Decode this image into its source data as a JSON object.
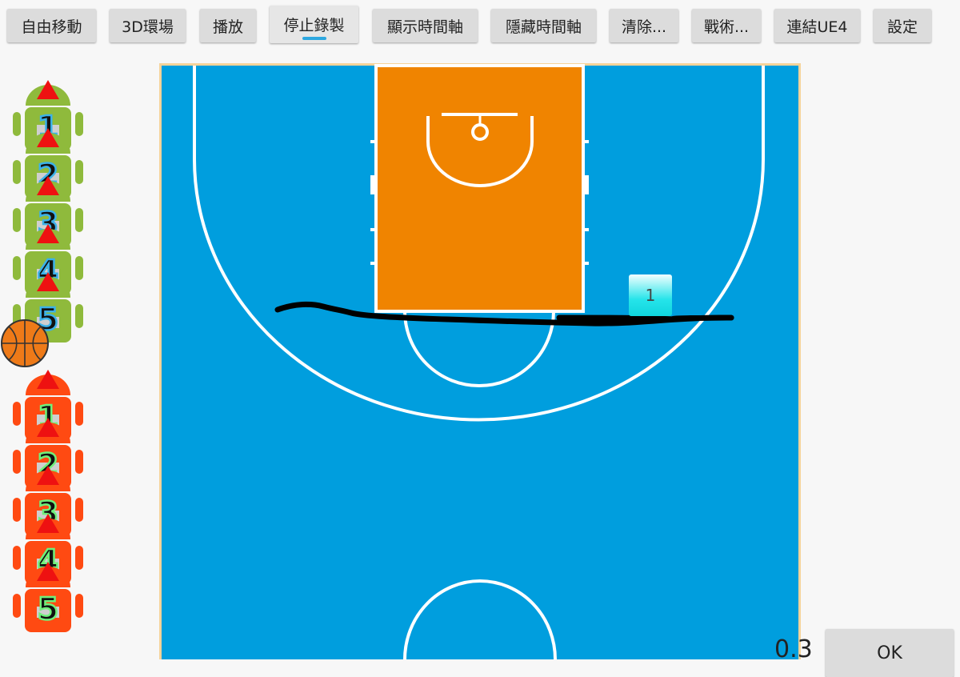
{
  "toolbar": {
    "buttons": [
      {
        "label": "自由移動"
      },
      {
        "label": "3D環場"
      },
      {
        "label": "播放"
      },
      {
        "label": "停止錄製"
      },
      {
        "label": "顯示時間軸"
      },
      {
        "label": "隱藏時間軸"
      },
      {
        "label": "清除..."
      },
      {
        "label": "戰術..."
      },
      {
        "label": "連結UE4"
      },
      {
        "label": "設定"
      }
    ]
  },
  "team_home": {
    "color": "#8fba3c",
    "players": [
      "1",
      "2",
      "3",
      "4",
      "5"
    ]
  },
  "team_away": {
    "color": "#ff4a12",
    "players": [
      "1",
      "2",
      "3",
      "4",
      "5"
    ]
  },
  "court": {
    "floor_color": "#009ede",
    "paint_color": "#f08400",
    "line_color": "#ffffff"
  },
  "path_label": "1",
  "speed": "0.3",
  "ok_label": "OK"
}
